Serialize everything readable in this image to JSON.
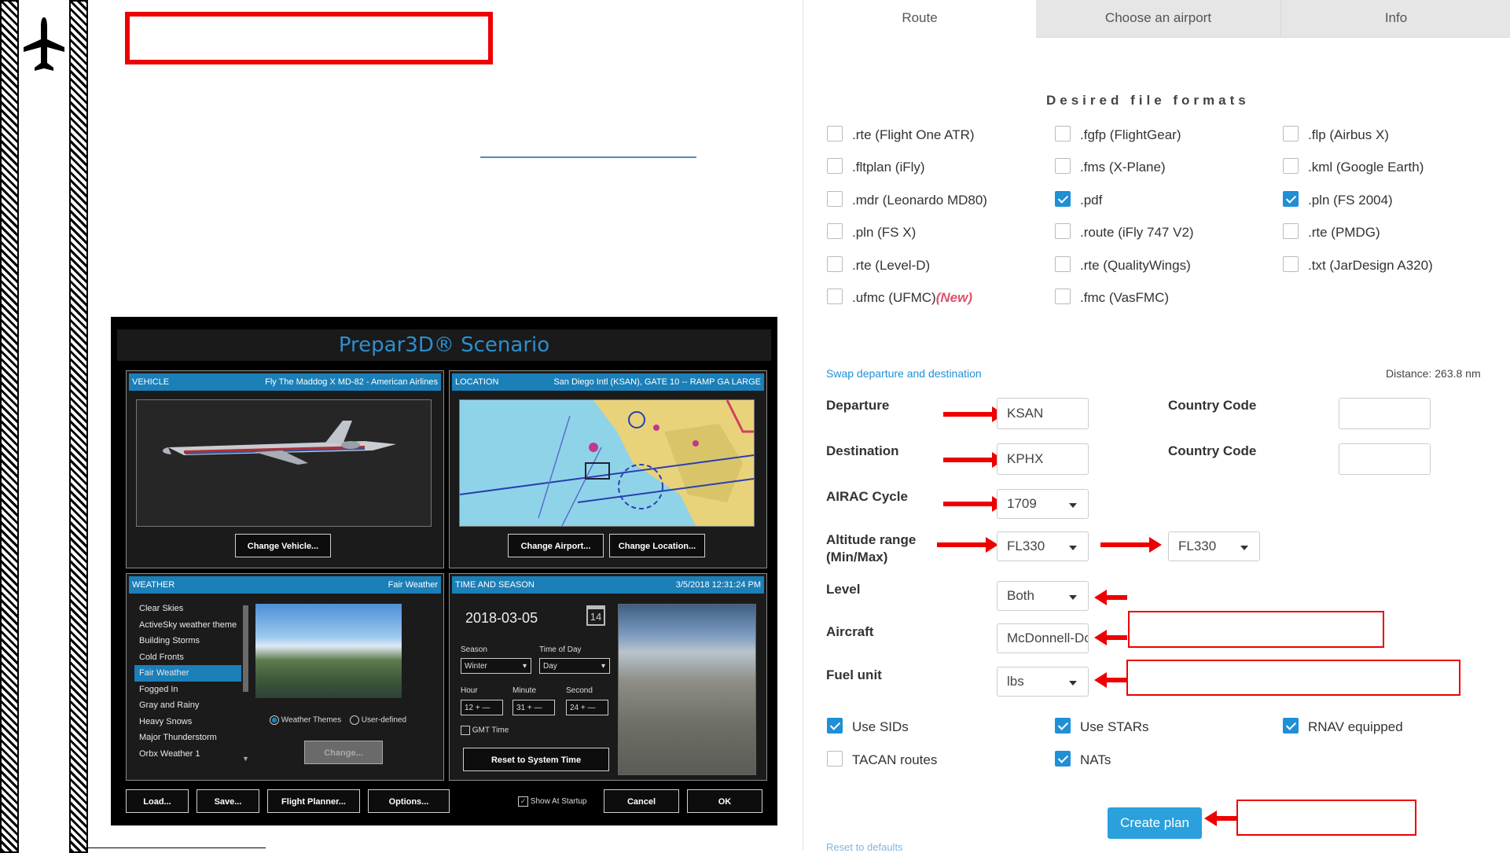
{
  "scenario": {
    "title": "Prepar3D® Scenario",
    "vehicle": {
      "header": "VEHICLE",
      "name": "Fly The Maddog X MD-82 - American Airlines",
      "button": "Change Vehicle..."
    },
    "location": {
      "header": "LOCATION",
      "name": "San Diego Intl (KSAN), GATE 10 -- RAMP GA LARGE",
      "buttons": [
        "Change Airport...",
        "Change Location..."
      ]
    },
    "weather": {
      "header": "WEATHER",
      "current": "Fair Weather",
      "items": [
        "Clear Skies",
        "ActiveSky weather theme",
        "Building Storms",
        "Cold Fronts",
        "Fair Weather",
        "Fogged In",
        "Gray and Rainy",
        "Heavy Snows",
        "Major Thunderstorm",
        "Orbx Weather 1"
      ],
      "selected_index": 4,
      "radio_themes": "Weather Themes",
      "radio_user": "User-defined",
      "change_button": "Change..."
    },
    "time": {
      "header": "TIME AND SEASON",
      "datetime": "3/5/2018 12:31:24 PM",
      "date": "2018-03-05",
      "calendar_day": "14",
      "season_label": "Season",
      "season": "Winter",
      "tod_label": "Time of Day",
      "tod": "Day",
      "hour_label": "Hour",
      "hour": "12",
      "minute_label": "Minute",
      "minute": "31",
      "second_label": "Second",
      "second": "24",
      "gmt": "GMT Time",
      "reset_button": "Reset to System Time"
    },
    "bottom": {
      "load": "Load...",
      "save": "Save...",
      "planner": "Flight Planner...",
      "options": "Options...",
      "show_startup": "Show At Startup",
      "cancel": "Cancel",
      "ok": "OK"
    }
  },
  "planner": {
    "tabs": [
      "Route",
      "Choose an airport",
      "Info"
    ],
    "formats_title": "Desired file formats",
    "formats": [
      [
        {
          "label": ".rte (Flight One ATR)",
          "checked": false
        },
        {
          "label": ".fgfp (FlightGear)",
          "checked": false
        },
        {
          "label": ".flp (Airbus X)",
          "checked": false
        }
      ],
      [
        {
          "label": ".fltplan (iFly)",
          "checked": false
        },
        {
          "label": ".fms (X-Plane)",
          "checked": false
        },
        {
          "label": ".kml (Google Earth)",
          "checked": false
        }
      ],
      [
        {
          "label": ".mdr (Leonardo MD80)",
          "checked": false
        },
        {
          "label": ".pdf",
          "checked": true
        },
        {
          "label": ".pln (FS 2004)",
          "checked": true
        }
      ],
      [
        {
          "label": ".pln (FS X)",
          "checked": false
        },
        {
          "label": ".route (iFly 747 V2)",
          "checked": false
        },
        {
          "label": ".rte (PMDG)",
          "checked": false
        }
      ],
      [
        {
          "label": ".rte (Level-D)",
          "checked": false
        },
        {
          "label": ".rte (QualityWings)",
          "checked": false
        },
        {
          "label": ".txt (JarDesign A320)",
          "checked": false
        }
      ],
      [
        {
          "label": ".ufmc (UFMC)",
          "checked": false
        },
        {
          "label": ".fmc (VasFMC)",
          "checked": false
        }
      ]
    ],
    "new_tag": "(New)",
    "swap_link": "Swap departure and destination",
    "distance": "Distance: 263.8 nm",
    "departure_label": "Departure",
    "departure": "KSAN",
    "destination_label": "Destination",
    "destination": "KPHX",
    "country_code_label": "Country Code",
    "airac_label": "AIRAC Cycle",
    "airac": "1709",
    "altitude_label_1": "Altitude range",
    "altitude_label_2": "(Min/Max)",
    "alt_min": "FL330",
    "alt_max": "FL330",
    "level_label": "Level",
    "level": "Both",
    "aircraft_label": "Aircraft",
    "aircraft": "McDonnell-Do",
    "fuel_label": "Fuel unit",
    "fuel": "lbs",
    "options": [
      {
        "label": "Use SIDs",
        "checked": true
      },
      {
        "label": "Use STARs",
        "checked": true
      },
      {
        "label": "RNAV equipped",
        "checked": true
      },
      {
        "label": "TACAN routes",
        "checked": false
      },
      {
        "label": "NATs",
        "checked": true
      }
    ],
    "create_button": "Create plan",
    "reset_link": "Reset to defaults"
  },
  "colors": {
    "accent": "#1f8fd6",
    "annotation": "#e00000",
    "p3d_header": "#1b7fb8"
  }
}
